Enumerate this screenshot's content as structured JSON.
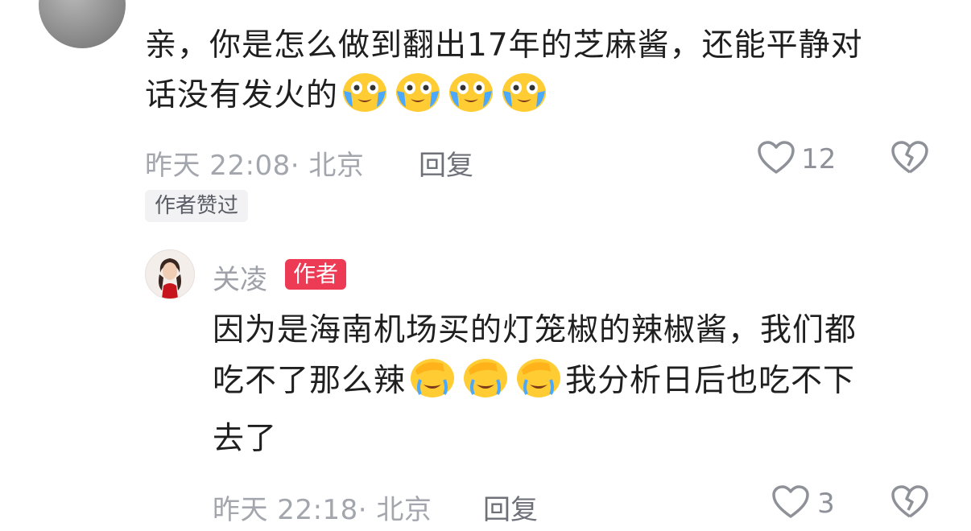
{
  "comment": {
    "line1": "亲，你是怎么做到翻出17年的芝麻酱，还能平静对",
    "line2": "话没有发火的",
    "emojis": [
      "crying-laughing-face-icon",
      "crying-laughing-face-icon",
      "crying-laughing-face-icon",
      "crying-laughing-face-icon"
    ],
    "time_location": "昨天 22:08· 北京",
    "reply_label": "回复",
    "like_count": "12",
    "author_liked_badge": "作者赞过"
  },
  "reply": {
    "author_name": "关凌",
    "author_badge": "作者",
    "line1": "因为是海南机场买的灯笼椒的辣椒酱，我们都",
    "line2_part1": "吃不了那么辣",
    "line2_part2": "我分析日后也吃不下",
    "line3": "去了",
    "emojis": [
      "face-palm-crying-icon",
      "face-palm-crying-icon",
      "face-palm-crying-icon"
    ],
    "time_location": "昨天 22:18· 北京",
    "reply_label": "回复",
    "like_count": "3"
  },
  "colors": {
    "author_badge_bg": "#ee3b55",
    "meta_text": "#a3a6ad"
  }
}
